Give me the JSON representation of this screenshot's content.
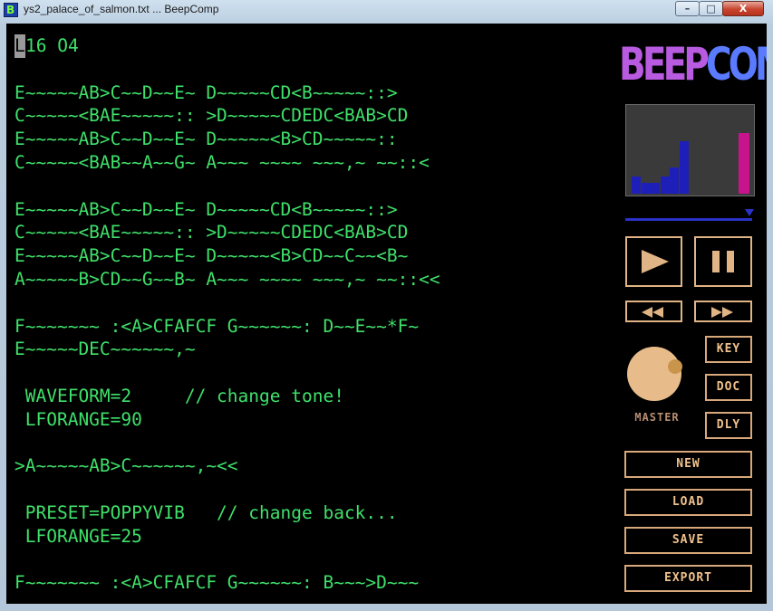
{
  "window": {
    "title": "ys2_palace_of_salmon.txt ... BeepComp",
    "app_icon_letter": "B",
    "minimize_glyph": "–",
    "maximize_glyph": "□",
    "close_glyph": "X"
  },
  "editor": {
    "first_char": "L",
    "lines": [
      "16 O4",
      "",
      "E~~~~~AB>C~~D~~E~ D~~~~~CD<B~~~~~::>",
      "C~~~~~<BAE~~~~~:: >D~~~~~CDEDC<BAB>CD",
      "E~~~~~AB>C~~D~~E~ D~~~~~<B>CD~~~~~::",
      "C~~~~~<BAB~~A~~G~ A~~~ ~~~~ ~~~,~ ~~::<",
      "",
      "E~~~~~AB>C~~D~~E~ D~~~~~CD<B~~~~~::>",
      "C~~~~~<BAE~~~~~:: >D~~~~~CDEDC<BAB>CD",
      "E~~~~~AB>C~~D~~E~ D~~~~~<B>CD~~C~~<B~",
      "A~~~~~B>CD~~G~~B~ A~~~ ~~~~ ~~~,~ ~~::<<",
      "",
      "F~~~~~~~ :<A>CFAFCF G~~~~~~: D~~E~~*F~",
      "E~~~~~DEC~~~~~~,~",
      "",
      " WAVEFORM=2     // change tone!",
      " LFORANGE=90",
      "",
      ">A~~~~~AB>C~~~~~~,~<<",
      "",
      " PRESET=POPPYVIB   // change back...",
      " LFORANGE=25",
      "",
      "F~~~~~~~ :<A>CFAFCF G~~~~~~: B~~~>D~~~"
    ]
  },
  "sidebar": {
    "logo_part1": "BEEP",
    "logo_part2": "COMP",
    "master_label": "MASTER",
    "key_button": "KEY",
    "doc_button": "DOC",
    "dly_button": "DLY",
    "new_button": "NEW",
    "load_button": "LOAD",
    "save_button": "SAVE",
    "export_button": "EXPORT"
  },
  "colors": {
    "editor_text": "#3fe06a",
    "button_border": "#d8a87a",
    "logo_purple": "#b85be0",
    "logo_blue": "#5a7bff",
    "meter_blue": "#1e1eb8",
    "meter_pink": "#c8148c"
  },
  "icons": {
    "play": "play-icon",
    "pause": "pause-icon",
    "rewind": "rewind-icon",
    "fast_forward": "fast-forward-icon",
    "knob": "volume-knob-icon"
  },
  "scope_levels": [
    0.2,
    0.13,
    0.13,
    0.2,
    0.3,
    0.6,
    0,
    0,
    0,
    0,
    0,
    0.7
  ]
}
